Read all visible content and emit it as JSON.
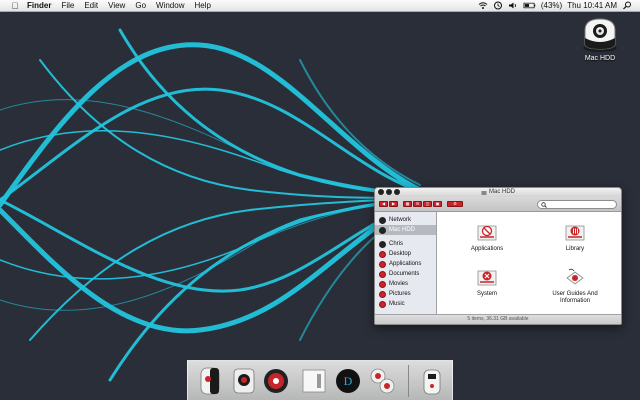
{
  "menubar": {
    "apple_icon": "apple-icon",
    "app_name": "Finder",
    "menus": [
      "File",
      "Edit",
      "View",
      "Go",
      "Window",
      "Help"
    ],
    "status_icons": [
      "wifi-icon",
      "time-machine-icon",
      "volume-icon",
      "battery-icon"
    ],
    "battery_percent": "(43%)",
    "clock": "Thu 10:41 AM",
    "spotlight_icon": "spotlight-icon"
  },
  "desktop": {
    "wallpaper_colors": {
      "background": "#2a2e38",
      "ribbon": "#22c4dd"
    },
    "hdd_icon": {
      "label": "Mac HDD"
    }
  },
  "window": {
    "title": "Mac HDD",
    "nav_buttons": [
      "back",
      "forward"
    ],
    "view_buttons": [
      "icon-view",
      "list-view",
      "column-view",
      "cover-flow"
    ],
    "action_button": "action",
    "search": {
      "value": "",
      "placeholder": ""
    },
    "sidebar": {
      "devices": [
        {
          "label": "Network",
          "icon": "network-icon"
        },
        {
          "label": "Mac HDD",
          "icon": "hdd-icon",
          "selected": true
        }
      ],
      "places": [
        {
          "label": "Chris",
          "icon": "home-icon"
        },
        {
          "label": "Desktop",
          "icon": "desktop-folder-icon"
        },
        {
          "label": "Applications",
          "icon": "applications-folder-icon"
        },
        {
          "label": "Documents",
          "icon": "documents-folder-icon"
        },
        {
          "label": "Movies",
          "icon": "movies-folder-icon"
        },
        {
          "label": "Pictures",
          "icon": "pictures-folder-icon"
        },
        {
          "label": "Music",
          "icon": "music-folder-icon"
        }
      ]
    },
    "items": [
      {
        "label": "Applications",
        "icon": "applications-folder-icon"
      },
      {
        "label": "Library",
        "icon": "library-folder-icon"
      },
      {
        "label": "System",
        "icon": "system-folder-icon"
      },
      {
        "label": "User Guides And Information",
        "icon": "user-guides-alias-icon"
      }
    ],
    "status": "5 items, 36.31 GB available"
  },
  "dock": {
    "apps": [
      "finder-icon",
      "dashboard-icon",
      "itunes-icon",
      "mail-icon",
      "address-book-icon",
      "ical-icon",
      "preferences-icon"
    ],
    "trash": "trash-icon"
  }
}
